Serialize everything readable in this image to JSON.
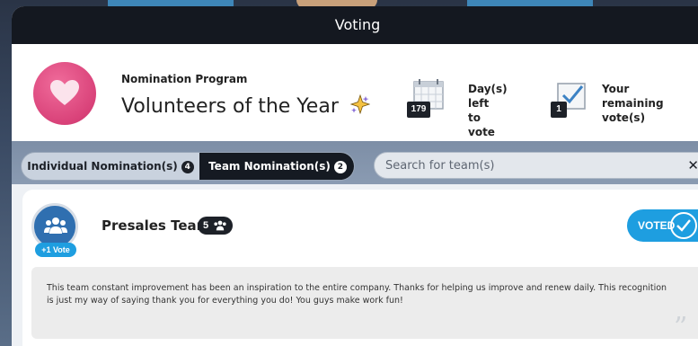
{
  "window": {
    "title": "Voting"
  },
  "program": {
    "label": "Nomination Program",
    "title": "Volunteers of the Year",
    "icon": "heart-icon",
    "accent": "#d94279"
  },
  "stats": {
    "days_left": {
      "count": "179",
      "label_line1": "Day(s) left",
      "label_line2": "to vote"
    },
    "remaining_votes": {
      "count": "1",
      "label_line1": "Your remaining",
      "label_line2": "vote(s)"
    }
  },
  "tabs": [
    {
      "label": "Individual Nomination(s)",
      "count": "4",
      "selected": false
    },
    {
      "label": "Team Nomination(s)",
      "count": "2",
      "selected": true
    }
  ],
  "search": {
    "placeholder": "Search for team(s)",
    "value": ""
  },
  "nomination": {
    "team_name": "Presales Team",
    "member_count": "5",
    "vote_badge": "+1 Vote",
    "status": "VOTED",
    "status_color": "#1e9ee0",
    "comment": "This team constant improvement has been an inspiration to the entire company. Thanks for helping us improve and renew daily. This recognition is just my way of saying thank you for everything you do! You guys make work fun!"
  }
}
